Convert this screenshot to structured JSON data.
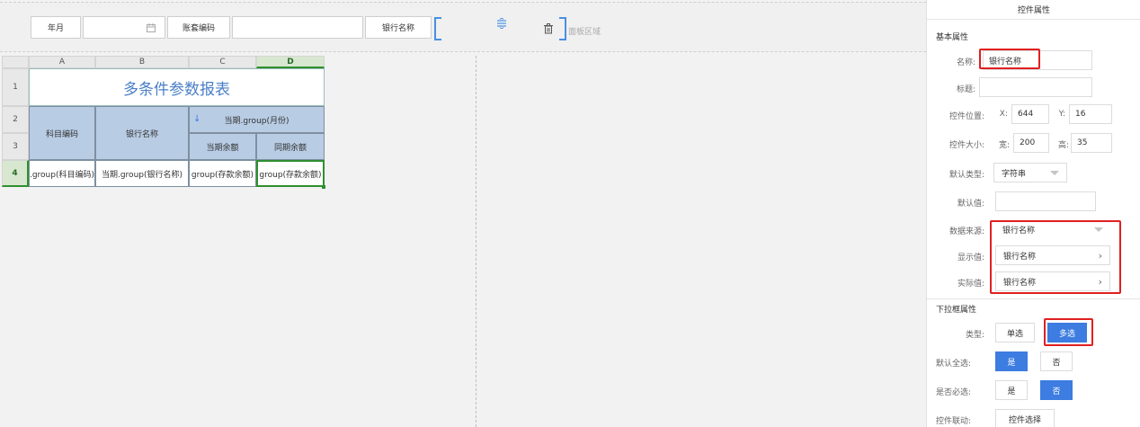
{
  "params": {
    "year_month_label": "年月",
    "account_label": "账套编码",
    "bank_label": "银行名称",
    "panel_area_label": "面板区域",
    "calendar_icon": "calendar-icon",
    "move_icon": "move-handle-icon",
    "delete_icon": "trash-icon"
  },
  "sheet": {
    "col_headers": [
      "A",
      "B",
      "C",
      "D"
    ],
    "row_headers": [
      "1",
      "2",
      "3",
      "4"
    ],
    "title": "多条件参数报表",
    "header_subject_code": "科目编码",
    "header_bank_name": "银行名称",
    "header_period_group": "当期.group(月份)",
    "header_group_arrow": "↓",
    "header_current_balance": "当期余额",
    "header_same_period_balance": "同期余额",
    "row4": [
      "期.group(科目编码)",
      "当期.group(银行名称)",
      "group(存款余额)",
      "group(存款余额)"
    ]
  },
  "props": {
    "title": "控件属性",
    "basic_section": "基本属性",
    "name_label": "名称:",
    "name_value": "银行名称",
    "caption_label": "标题:",
    "caption_value": "",
    "pos_label": "控件位置:",
    "x_label": "X:",
    "x_value": "644",
    "y_label": "Y:",
    "y_value": "16",
    "size_label": "控件大小:",
    "width_label": "宽:",
    "width_value": "200",
    "height_label": "高:",
    "height_value": "35",
    "default_type_label": "默认类型:",
    "default_type_value": "字符串",
    "default_value_label": "默认值:",
    "default_value_value": "",
    "datasource_label": "数据来源:",
    "datasource_value": "银行名称",
    "display_label": "显示值:",
    "display_value": "银行名称",
    "actual_label": "实际值:",
    "actual_value": "银行名称",
    "dropdown_section": "下拉框属性",
    "type_label": "类型:",
    "single_label": "单选",
    "multi_label": "多选",
    "default_all_label": "默认全选:",
    "yes_label": "是",
    "no_label": "否",
    "required_label": "是否必选:",
    "linkage_label": "控件联动:",
    "linkage_button": "控件选择"
  },
  "colors": {
    "accent": "#3d7ce0",
    "highlight": "#e02020",
    "header_fill": "#b8cce4",
    "title_text": "#4a7fc8",
    "selection": "#2f8f2f"
  }
}
